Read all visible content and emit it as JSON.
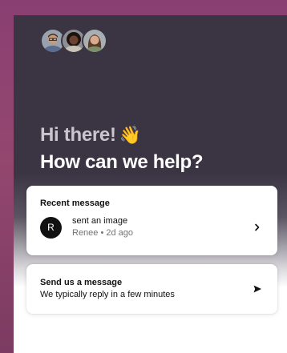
{
  "header": {
    "greeting_line1": "Hi there!",
    "greeting_emoji": "👋",
    "greeting_line2": "How can we help?",
    "team_avatars": [
      {
        "icon": "team-member-avatar",
        "skin": "#c99a7a",
        "hair": "#3b2a20",
        "shirt": "#5a6d8f"
      },
      {
        "icon": "team-member-avatar",
        "skin": "#6b4130",
        "hair": "#1d1410",
        "shirt": "#c9c2b8"
      },
      {
        "icon": "team-member-avatar",
        "skin": "#d8ab8f",
        "hair": "#5a3b26",
        "shirt": "#7d8f6a"
      }
    ]
  },
  "recent_message": {
    "title": "Recent message",
    "avatar_initial": "R",
    "text": "sent an image",
    "meta": "Renee • 2d ago"
  },
  "send_message": {
    "title": "Send us a message",
    "subtitle": "We typically reply in a few minutes"
  },
  "colors": {
    "hero_background": "#3a3443",
    "page_background": "#8a3f73",
    "card_background": "#ffffff"
  }
}
